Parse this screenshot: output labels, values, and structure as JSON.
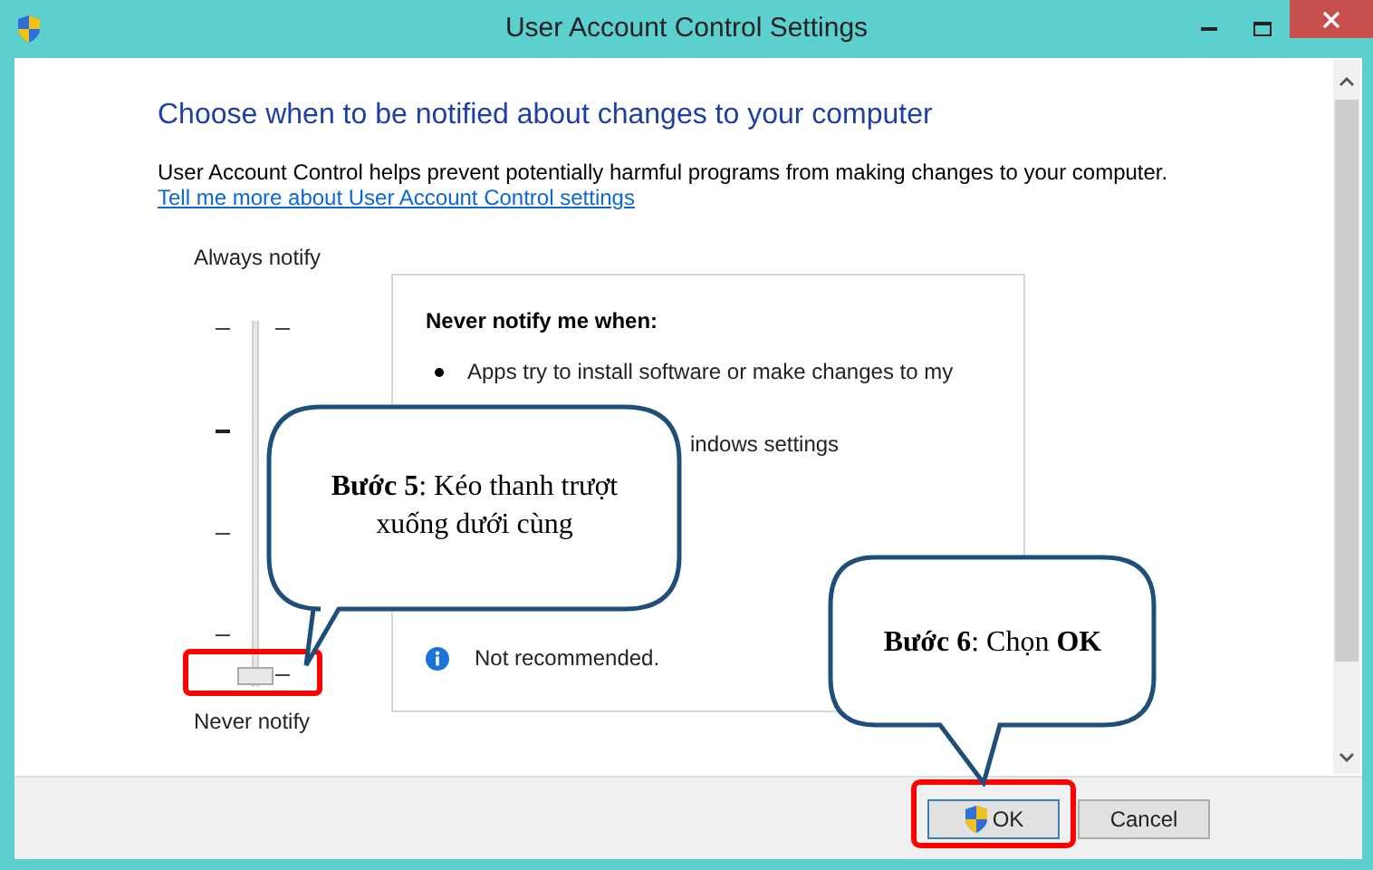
{
  "window": {
    "title": "User Account Control Settings"
  },
  "heading": "Choose when to be notified about changes to your computer",
  "description": "User Account Control helps prevent potentially harmful programs from making changes to your computer.",
  "link": "Tell me more about User Account Control settings",
  "slider": {
    "top_label": "Always notify",
    "bottom_label": "Never notify",
    "level": 0
  },
  "panel": {
    "title": "Never notify me when:",
    "bullets": [
      "Apps try to install software or make changes to my"
    ],
    "partial_line": "indows settings",
    "note": "Not recommended."
  },
  "buttons": [
    {
      "label": "OK",
      "shield": true,
      "default": true
    },
    {
      "label": "Cancel",
      "shield": false,
      "default": false
    }
  ],
  "callouts": [
    {
      "text": "**Bước 5**: Kéo thanh trượt xuống dưới cùng"
    },
    {
      "text": "**Bước 6**: Chọn **OK**"
    }
  ]
}
